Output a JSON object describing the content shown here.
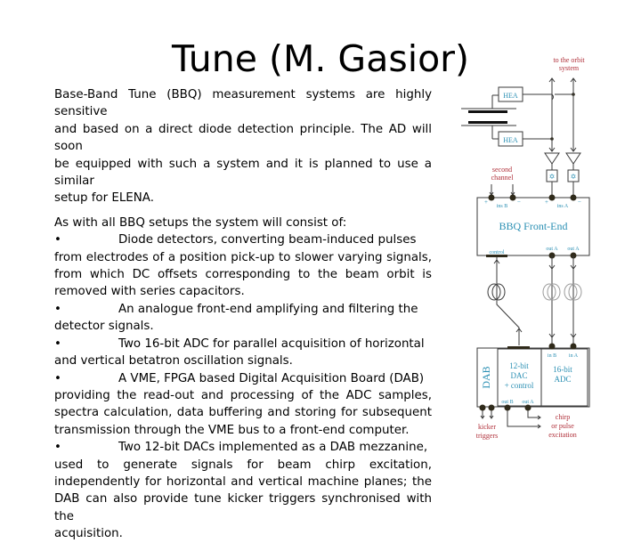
{
  "slide": {
    "title": "Tune (M. Gasior)",
    "intro": [
      "Base-Band Tune (BBQ) measurement systems are highly sensitive",
      "and based on a direct diode detection principle. The AD will soon",
      "be equipped with such a system and it is planned to use a similar",
      "setup for ELENA."
    ],
    "list_intro": "As with all BBQ setups the system will consist of:",
    "bullet_symbol": "•",
    "bullets": [
      {
        "first": "Diode detectors, converting beam-induced pulses",
        "rest": [
          "from electrodes of a position pick-up to slower varying signals,",
          "from which DC offsets corresponding to the beam orbit is",
          "removed with series capacitors."
        ]
      },
      {
        "first": "An analogue front-end amplifying and filtering the",
        "rest": [
          "detector signals."
        ]
      },
      {
        "first": "Two 16-bit ADC for parallel acquisition of horizontal",
        "rest": [
          "and vertical betatron oscillation signals."
        ]
      },
      {
        "first": "A VME, FPGA based Digital Acquisition Board (DAB)",
        "rest": [
          "providing the read-out and processing of the ADC samples,",
          "spectra calculation, data buffering and storing for subsequent",
          "transmission through the VME bus to a front-end computer."
        ]
      },
      {
        "first": "Two 12-bit DACs implemented as a DAB mezzanine,",
        "rest": [
          "used to generate signals for beam chirp excitation,",
          "independently for horizontal and vertical machine planes; the",
          "DAB can also provide tune kicker triggers synchronised with the",
          "acquisition."
        ]
      }
    ]
  },
  "diagram": {
    "to_orbit_1": "to the orbit",
    "to_orbit_2": "system",
    "hea_top": "HEA",
    "hea_bottom": "HEA",
    "second_channel_1": "second",
    "second_channel_2": "channel",
    "plus": "+",
    "minus": "−",
    "ins_b": "ins B",
    "ins_a": "ins A",
    "frontend_label": "BBQ Front-End",
    "control": "control",
    "out_a1": "out A",
    "out_a2": "out A",
    "dab_label": "DAB",
    "dac_1": "12-bit",
    "dac_2": "DAC",
    "dac_3": "+ control",
    "adc_1": "16-bit",
    "adc_2": "ADC",
    "in_b": "in B",
    "in_a": "in A",
    "out_b": "out B",
    "out_a": "out A",
    "kicker_1": "kicker",
    "kicker_2": "triggers",
    "chirp_1": "chirp",
    "chirp_2": "or pulse",
    "chirp_3": "excitation",
    "colors": {
      "label_red": "#b0303a",
      "label_blue": "#2a8fb3",
      "line": "#3a3a3a",
      "node": "#2f2a1a"
    }
  }
}
